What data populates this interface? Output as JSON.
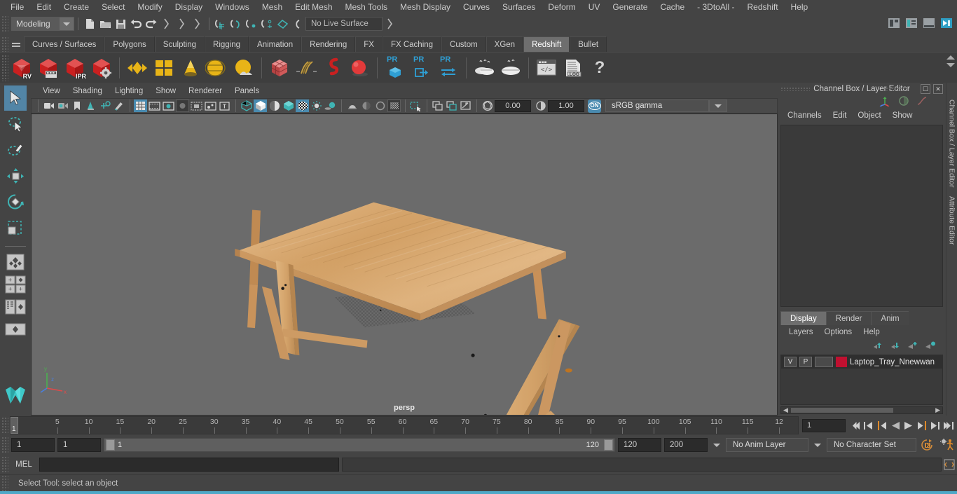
{
  "app": {
    "title": "Autodesk Maya"
  },
  "menubar": {
    "items": [
      "File",
      "Edit",
      "Create",
      "Select",
      "Modify",
      "Display",
      "Windows",
      "Mesh",
      "Edit Mesh",
      "Mesh Tools",
      "Mesh Display",
      "Curves",
      "Surfaces",
      "Deform",
      "UV",
      "Generate",
      "Cache",
      "- 3DtoAll -",
      "Redshift",
      "Help"
    ]
  },
  "statusline": {
    "menuset": "Modeling",
    "live_surface": "No Live Surface",
    "icons": [
      "new-scene-icon",
      "open-scene-icon",
      "save-scene-icon",
      "undo-icon",
      "redo-icon",
      "select-by-hierarchy-icon",
      "select-by-object-icon",
      "select-by-component-icon",
      "snap-to-grid-icon",
      "snap-to-curve-icon",
      "snap-to-point-icon",
      "snap-to-projected-center-icon",
      "snap-to-view-plane-icon",
      "make-live-icon"
    ],
    "right_icons": [
      "show-hide-modeling-toolkit-icon",
      "show-hide-attribute-editor-icon",
      "show-hide-tool-settings-icon",
      "show-hide-channel-box-icon"
    ]
  },
  "shelf": {
    "tabs": [
      "Curves / Surfaces",
      "Polygons",
      "Sculpting",
      "Rigging",
      "Animation",
      "Rendering",
      "FX",
      "FX Caching",
      "Custom",
      "XGen",
      "Redshift",
      "Bullet"
    ],
    "active_tab": "Redshift",
    "buttons": [
      {
        "name": "redshift-render-view",
        "label": "RV"
      },
      {
        "name": "redshift-render-sequence",
        "label": ""
      },
      {
        "name": "redshift-ipr",
        "label": "IPR"
      },
      {
        "name": "redshift-render-settings",
        "label": ""
      },
      {
        "name": "redshift-material",
        "label": ""
      },
      {
        "name": "redshift-material-blender",
        "label": ""
      },
      {
        "name": "redshift-light-cone",
        "label": ""
      },
      {
        "name": "redshift-dome-light",
        "label": ""
      },
      {
        "name": "redshift-environment",
        "label": ""
      },
      {
        "name": "redshift-proxy",
        "label": ""
      },
      {
        "name": "redshift-hair",
        "label": ""
      },
      {
        "name": "redshift-volume",
        "label": ""
      },
      {
        "name": "redshift-sphere-light",
        "label": ""
      },
      {
        "name": "redshift-pr-object",
        "label": "PR"
      },
      {
        "name": "redshift-pr-export",
        "label": "PR"
      },
      {
        "name": "redshift-pr-transfer",
        "label": "PR"
      },
      {
        "name": "redshift-bake-set",
        "label": ""
      },
      {
        "name": "redshift-bake-render",
        "label": ""
      },
      {
        "name": "redshift-script-editor",
        "label": ""
      },
      {
        "name": "redshift-log-file",
        "label": ".LOG"
      },
      {
        "name": "redshift-help",
        "label": "?"
      }
    ]
  },
  "toolbox": {
    "items": [
      {
        "name": "select-tool",
        "selected": true
      },
      {
        "name": "lasso-select-tool",
        "selected": false
      },
      {
        "name": "paint-select-tool",
        "selected": false
      },
      {
        "name": "move-tool",
        "selected": false
      },
      {
        "name": "rotate-tool",
        "selected": false
      },
      {
        "name": "scale-tool",
        "selected": false
      },
      {
        "name": "last-tool-used",
        "selected": false
      },
      {
        "name": "single-perspective-view-layout",
        "selected": false
      },
      {
        "name": "four-view-layout",
        "selected": false
      },
      {
        "name": "persp-outliner-layout",
        "selected": false
      },
      {
        "name": "persp-graph-editor-layout",
        "selected": false
      },
      {
        "name": "bookmark-layout",
        "selected": false
      }
    ]
  },
  "viewport": {
    "menus": [
      "View",
      "Shading",
      "Lighting",
      "Show",
      "Renderer",
      "Panels"
    ],
    "camera_label": "persp",
    "exposure": "0.00",
    "gamma": "1.00",
    "color_management": "sRGB gamma",
    "color_management_toggle": "ON",
    "toolbar_icons": [
      "select-camera-icon",
      "camera-attributes-icon",
      "bookmark-icon",
      "image-plane-icon",
      "two-d-pan-zoom-icon",
      "grease-pencil-icon",
      "grid-icon",
      "film-gate-icon",
      "resolution-gate-icon",
      "gate-mask-icon",
      "film-origin-icon",
      "safe-action-icon",
      "title-safe-icon",
      "wireframe-icon",
      "smooth-shade-all-icon",
      "shade-with-wireframe-icon",
      "use-default-material-icon",
      "textured-icon",
      "use-all-lights-icon",
      "shadows-icon",
      "screen-space-ao-icon",
      "motion-blur-icon",
      "multisample-aa-icon",
      "isolate-select-icon",
      "xray-icon",
      "xray-joints-icon",
      "xray-active-components-icon",
      "exposure-icon",
      "gamma-icon",
      "color-management-icon"
    ]
  },
  "channelbox": {
    "panel_title": "Channel Box / Layer Editor",
    "menus": [
      "Channels",
      "Edit",
      "Object",
      "Show"
    ],
    "window_buttons": [
      "restore-panel-icon",
      "close-panel-icon"
    ],
    "header_icons": [
      "axis-orientation-icon",
      "channel-speed-icon",
      "channel-curve-icon"
    ]
  },
  "layer_editor": {
    "tabs": [
      "Display",
      "Render",
      "Anim"
    ],
    "active_tab": "Display",
    "menus": [
      "Layers",
      "Options",
      "Help"
    ],
    "buttons": [
      "move-layer-up-icon",
      "move-layer-down-icon",
      "create-new-layer-icon",
      "create-layer-from-selected-icon"
    ],
    "layers": [
      {
        "visibility": "V",
        "playback": "P",
        "reference": "",
        "color": "#c01030",
        "name": "Laptop_Tray_Nnewwan"
      }
    ]
  },
  "dock": {
    "labels": [
      "Channel Box / Layer Editor",
      "Attribute Editor"
    ]
  },
  "timeslider": {
    "tick_labels": [
      "5",
      "10",
      "15",
      "20",
      "25",
      "30",
      "35",
      "40",
      "45",
      "50",
      "55",
      "60",
      "65",
      "70",
      "75",
      "80",
      "85",
      "90",
      "95",
      "100",
      "105",
      "110",
      "115",
      "12"
    ],
    "current_frame": "1",
    "current_frame_field": "1",
    "playback_buttons": [
      "go-to-start-icon",
      "step-back-keyframe-icon",
      "step-back-frame-icon",
      "play-backwards-icon",
      "play-forwards-icon",
      "step-forward-frame-icon",
      "step-forward-keyframe-icon",
      "go-to-end-icon"
    ]
  },
  "rangeslider": {
    "anim_start": "1",
    "range_start": "1",
    "bar_start": "1",
    "bar_end": "120",
    "range_end": "120",
    "anim_end": "200",
    "anim_layer": "No Anim Layer",
    "character_set": "No Character Set",
    "right_icons": [
      "auto-keyframe-icon",
      "animation-preferences-icon"
    ]
  },
  "command_line": {
    "language_label": "MEL",
    "input_value": "",
    "input_placeholder": "",
    "output_value": "",
    "script-editor-icon": "script-editor-icon"
  },
  "helpline": {
    "text": "Select Tool: select an object"
  },
  "colors": {
    "accent_blue": "#4a8bb0",
    "shelf_red": "#d02b2b",
    "shelf_yellow": "#e8b417",
    "layer_red": "#c01030",
    "viewport_bg": "#6b6b6b",
    "wood": "#d9a86a"
  }
}
